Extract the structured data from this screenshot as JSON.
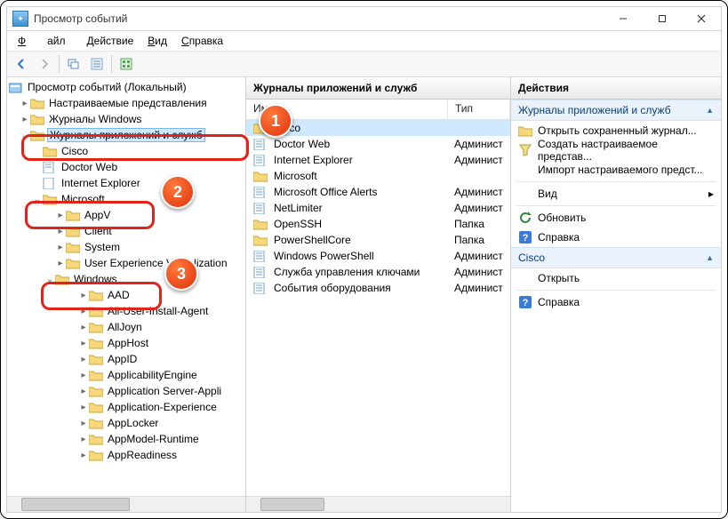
{
  "window": {
    "title": "Просмотр событий"
  },
  "menu": {
    "file": "Файл",
    "action": "Действие",
    "view": "Вид",
    "help": "Справка"
  },
  "tree": {
    "root": "Просмотр событий (Локальный)",
    "custom_views": "Настраиваемые представления",
    "win_logs": "Журналы Windows",
    "app_services": "Журналы приложений и служб",
    "cisco": "Cisco",
    "doctor_web": "Doctor Web",
    "ie": "Internet Explorer",
    "microsoft": "Microsoft",
    "appv": "AppV",
    "client": "Client",
    "system": "System",
    "uev": "User Experience Virtualization",
    "windows": "Windows",
    "aad": "AAD",
    "all_user": "All-User-Install-Agent",
    "alljoyn": "AllJoyn",
    "apphost": "AppHost",
    "appid": "AppID",
    "applicability": "ApplicabilityEngine",
    "app_server": "Application Server-Appli",
    "app_exp": "Application-Experience",
    "applocker": "AppLocker",
    "appmodel": "AppModel-Runtime",
    "appreadiness": "AppReadiness"
  },
  "mid": {
    "title": "Журналы приложений и служб",
    "col_name": "Имя",
    "col_type": "Тип",
    "rows": [
      {
        "name": "Cisco",
        "type": ""
      },
      {
        "name": "Doctor Web",
        "type": "Админист"
      },
      {
        "name": "Internet Explorer",
        "type": "Админист"
      },
      {
        "name": "Microsoft",
        "type": ""
      },
      {
        "name": "Microsoft Office Alerts",
        "type": "Админист"
      },
      {
        "name": "NetLimiter",
        "type": "Админист"
      },
      {
        "name": "OpenSSH",
        "type": "Папка"
      },
      {
        "name": "PowerShellCore",
        "type": "Папка"
      },
      {
        "name": "Windows PowerShell",
        "type": "Админист"
      },
      {
        "name": "Служба управления ключами",
        "type": "Админист"
      },
      {
        "name": "События оборудования",
        "type": "Админист"
      }
    ]
  },
  "actions": {
    "title": "Действия",
    "section1": "Журналы приложений и служб",
    "open_saved": "Открыть сохраненный журнал...",
    "create_view": "Создать настраиваемое представ...",
    "import_view": "Импорт настраиваемого предст...",
    "view": "Вид",
    "refresh": "Обновить",
    "help": "Справка",
    "section2": "Cisco",
    "open": "Открыть",
    "help2": "Справка"
  },
  "badges": {
    "b1": "1",
    "b2": "2",
    "b3": "3"
  }
}
